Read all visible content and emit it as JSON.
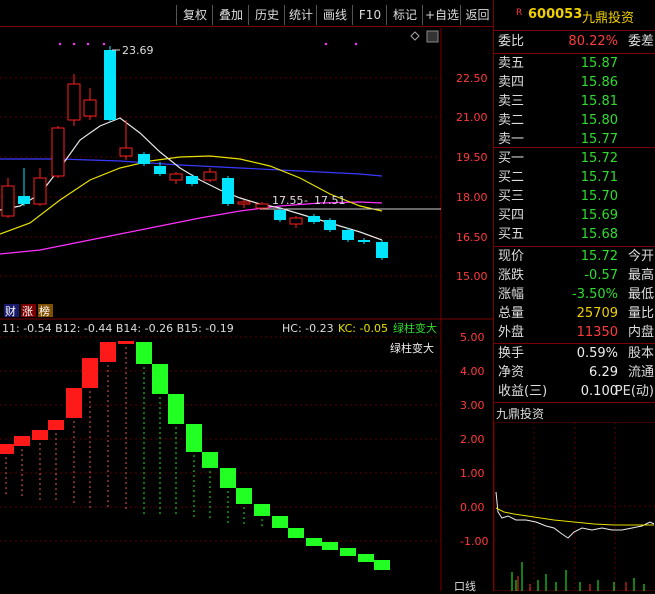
{
  "toolbar": {
    "buttons": [
      "复权",
      "叠加",
      "历史",
      "统计",
      "画线",
      "F10",
      "标记",
      "+自选",
      "返回"
    ]
  },
  "main_chart": {
    "price_labels": [
      "22.50",
      "21.00",
      "19.50",
      "18.00",
      "16.50",
      "15.00"
    ],
    "high_label": "23.69",
    "ref_label_1": "17.55",
    "ref_label_2": "17.51",
    "ref_label_sep": "-",
    "tag_cai": "财",
    "tag_zhang": "涨",
    "tag_bang": "榜"
  },
  "indicator": {
    "legend_left": "11: -0.54  B12: -0.44  B14: -0.26  B15: -0.19",
    "hc_label": "HC: -0.23",
    "kc_label": "KC: -0.05",
    "signal_label": "绿柱变大",
    "signal_note": "绿柱变大",
    "scale_labels": [
      "5.00",
      "4.00",
      "3.00",
      "2.00",
      "1.00",
      "0.00",
      "-1.00"
    ]
  },
  "quote": {
    "badge": "R",
    "code": "600053",
    "name": "九鼎投资",
    "webi_label": "委比",
    "webi_value": "80.22%",
    "weicha_label": "委差",
    "sell": [
      {
        "label": "卖五",
        "price": "15.87"
      },
      {
        "label": "卖四",
        "price": "15.86"
      },
      {
        "label": "卖三",
        "price": "15.81"
      },
      {
        "label": "卖二",
        "price": "15.80"
      },
      {
        "label": "卖一",
        "price": "15.77"
      }
    ],
    "buy": [
      {
        "label": "买一",
        "price": "15.72"
      },
      {
        "label": "买二",
        "price": "15.71"
      },
      {
        "label": "买三",
        "price": "15.70"
      },
      {
        "label": "买四",
        "price": "15.69"
      },
      {
        "label": "买五",
        "price": "15.68"
      }
    ],
    "stats": [
      {
        "label": "现价",
        "value": "15.72",
        "label2": "今开"
      },
      {
        "label": "涨跌",
        "value": "-0.57",
        "label2": "最高"
      },
      {
        "label": "涨幅",
        "value": "-3.50%",
        "label2": "最低"
      },
      {
        "label": "总量",
        "value": "25709",
        "label2": "量比"
      },
      {
        "label": "外盘",
        "value": "11350",
        "label2": "内盘"
      }
    ],
    "stats2": [
      {
        "label": "换手",
        "value": "0.59%",
        "label2": "股本"
      },
      {
        "label": "净资",
        "value": "6.29",
        "label2": "流通"
      },
      {
        "label": "收益(三)",
        "value": "0.100",
        "label2": "PE(动)"
      }
    ],
    "mini_title": "九鼎投资",
    "bottom_label": "口线"
  },
  "colors": {
    "up": "#ff2020",
    "down": "#00e5ff",
    "green_bar": "#22ff22",
    "red_bar": "#ff1a1a",
    "ma_white": "#e8e8e8",
    "ma_yellow": "#e8e000",
    "ma_blue": "#3a3aff",
    "ma_magenta": "#ff30ff"
  }
}
